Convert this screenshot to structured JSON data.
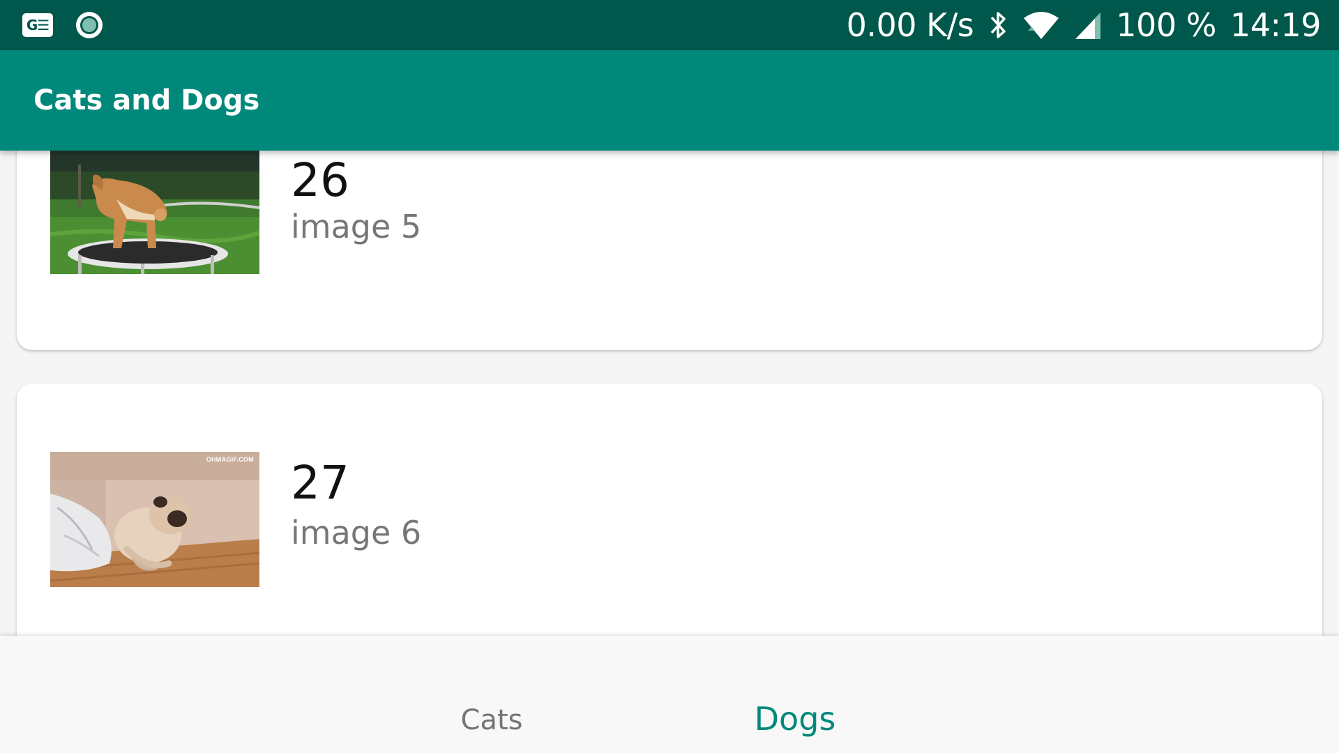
{
  "status_bar": {
    "left_icons": [
      "ge-badge-icon",
      "ring-circle-icon"
    ],
    "ge_badge_text": "G☰",
    "network_speed": "0.00 K/s",
    "icons": [
      "bluetooth-icon",
      "wifi-icon",
      "cell-signal-icon"
    ],
    "battery": "100 %",
    "time": "14:19",
    "background_color": "#00574b"
  },
  "app_bar": {
    "title": "Cats and Dogs",
    "background_color": "#00897b"
  },
  "list": {
    "items": [
      {
        "number": "26",
        "subtitle": "image 5",
        "thumbnail": "shiba-dog-on-trampoline-image"
      },
      {
        "number": "27",
        "subtitle": "image 6",
        "thumbnail": "pug-sitting-on-floor-image",
        "watermark": "OHMAGIF.COM"
      }
    ]
  },
  "bottom_nav": {
    "tabs": [
      {
        "label": "Cats",
        "selected": false
      },
      {
        "label": "Dogs",
        "selected": true
      }
    ],
    "accent_color": "#00897b"
  }
}
